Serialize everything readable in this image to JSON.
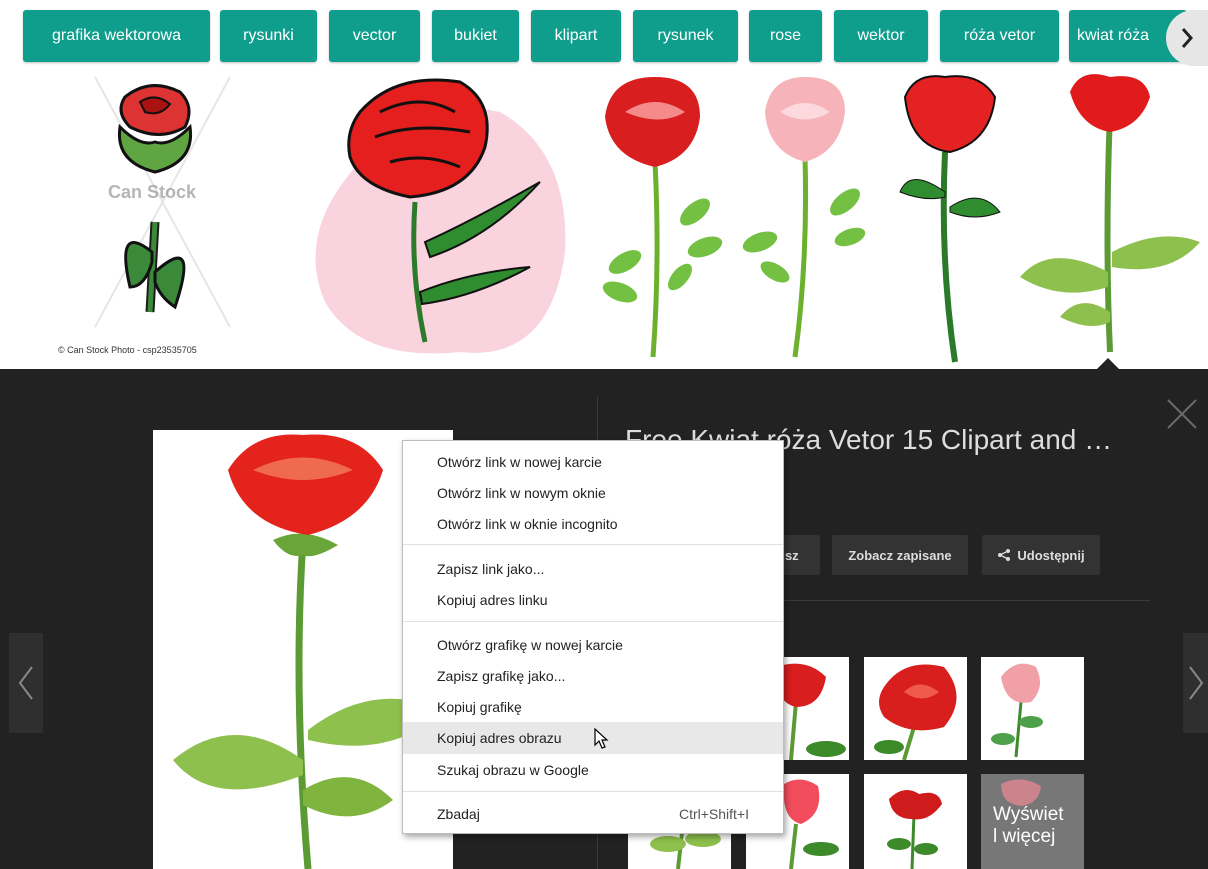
{
  "chips": [
    {
      "label": "grafika wektorowa"
    },
    {
      "label": "rysunki"
    },
    {
      "label": "vector"
    },
    {
      "label": "bukiet"
    },
    {
      "label": "klipart"
    },
    {
      "label": "rysunek"
    },
    {
      "label": "rose"
    },
    {
      "label": "wektor"
    },
    {
      "label": "róża vetor"
    },
    {
      "label": "kwiat róża"
    }
  ],
  "strip": {
    "watermark": "© Can Stock Photo - csp23535705",
    "logo_text": "Can Stock"
  },
  "panel": {
    "title": "Free Kwiat róża Vetor 15 Clipart and …",
    "buttons": {
      "save": "isz",
      "view_saved": "Zobacz zapisane",
      "share": "Udostępnij"
    },
    "more_label": "Wyświet\nl więcej"
  },
  "context_menu": {
    "items": [
      {
        "label": "Otwórz link w nowej karcie"
      },
      {
        "label": "Otwórz link w nowym oknie"
      },
      {
        "label": "Otwórz link w oknie incognito"
      },
      {
        "label": "Zapisz link jako..."
      },
      {
        "label": "Kopiuj adres linku"
      },
      {
        "label": "Otwórz grafikę w nowej karcie"
      },
      {
        "label": "Zapisz grafikę jako..."
      },
      {
        "label": "Kopiuj grafikę"
      },
      {
        "label": "Kopiuj adres obrazu"
      },
      {
        "label": "Szukaj obrazu w Google"
      },
      {
        "label": "Zbadaj",
        "shortcut": "Ctrl+Shift+I"
      }
    ],
    "hovered": "Kopiuj adres obrazu"
  },
  "colors": {
    "chip_bg": "#0f9d8c",
    "panel_bg": "#222222",
    "rose_red": "#e3231c"
  }
}
